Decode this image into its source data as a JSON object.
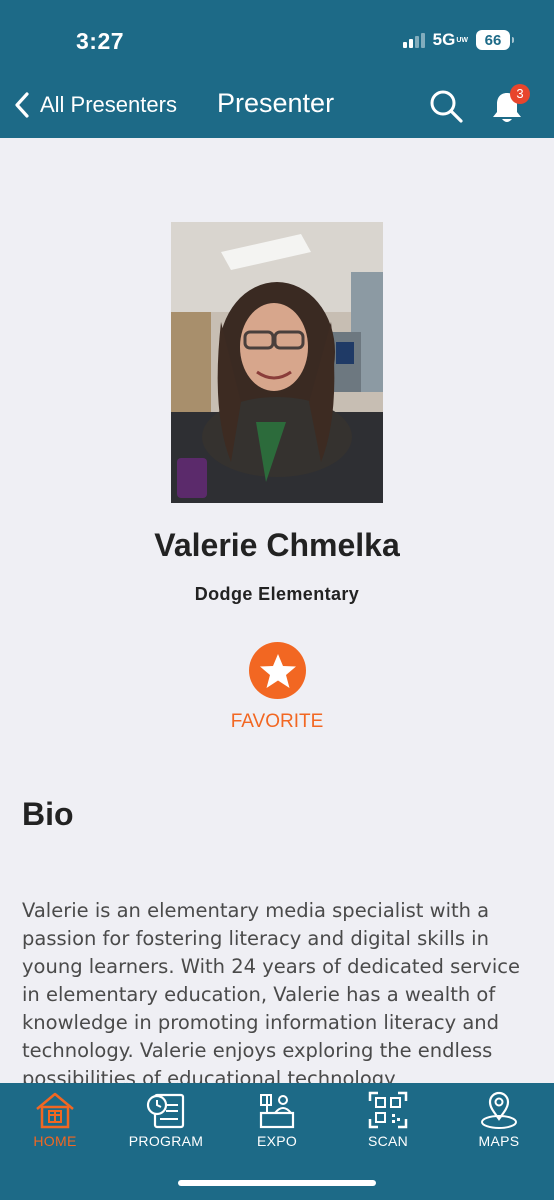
{
  "status_bar": {
    "time": "3:27",
    "network": "5G",
    "network_sub": "UW",
    "battery": "66"
  },
  "nav": {
    "back_label": "All Presenters",
    "title": "Presenter",
    "notification_count": "3",
    "icons": [
      "chevron-left-icon",
      "search-icon",
      "bell-icon"
    ]
  },
  "presenter": {
    "name": "Valerie Chmelka",
    "organization": "Dodge Elementary",
    "favorite_label": "FAVORITE"
  },
  "bio": {
    "heading": "Bio",
    "text": "Valerie is an elementary media specialist with a passion for fostering literacy and digital skills in young learners. With 24 years of dedicated service in elementary education, Valerie has a wealth of knowledge in promoting information literacy and technology. Valerie enjoys exploring the endless possibilities of educational technology"
  },
  "tabs": [
    {
      "label": "HOME",
      "icon": "home-icon",
      "active": true
    },
    {
      "label": "PROGRAM",
      "icon": "program-icon",
      "active": false
    },
    {
      "label": "EXPO",
      "icon": "expo-icon",
      "active": false
    },
    {
      "label": "SCAN",
      "icon": "qr-scan-icon",
      "active": false
    },
    {
      "label": "MAPS",
      "icon": "map-pin-icon",
      "active": false
    }
  ],
  "colors": {
    "header": "#1d6a87",
    "accent": "#f26722",
    "background": "#efeff4",
    "badge": "#e8452c"
  }
}
